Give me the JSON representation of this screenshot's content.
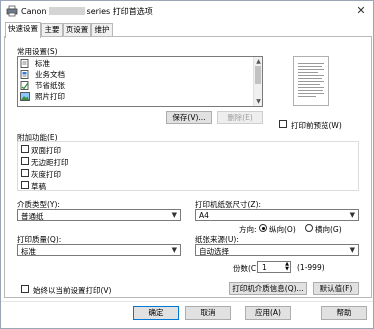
{
  "window": {
    "title_prefix": "Canon",
    "title_suffix": "series 打印首选项",
    "close_glyph": "✕"
  },
  "tabs": [
    {
      "label": "快速设置",
      "active": true
    },
    {
      "label": "主要",
      "active": false
    },
    {
      "label": "页设置",
      "active": false
    },
    {
      "label": "维护",
      "active": false
    }
  ],
  "common_settings": {
    "label": "常用设置(S)",
    "items": [
      {
        "label": "标准",
        "icon": "standard-document-icon"
      },
      {
        "label": "业务文档",
        "icon": "business-document-icon"
      },
      {
        "label": "节省纸张",
        "icon": "paper-saving-icon"
      },
      {
        "label": "照片打印",
        "icon": "photo-print-icon"
      }
    ],
    "save_label": "保存(V)...",
    "delete_label": "删除(E)"
  },
  "preview": {
    "preview_before_print_label": "打印前预览(W)"
  },
  "additional_features": {
    "label": "附加功能(E)",
    "items": [
      {
        "label": "双面打印",
        "checked": false
      },
      {
        "label": "无边距打印",
        "checked": false
      },
      {
        "label": "灰度打印",
        "checked": false
      },
      {
        "label": "草稿",
        "checked": false
      }
    ]
  },
  "media_type": {
    "label": "介质类型(Y):",
    "value": "普通纸"
  },
  "print_quality": {
    "label": "打印质量(Q):",
    "value": "标准"
  },
  "printer_paper_size": {
    "label": "打印机纸张尺寸(Z):",
    "value": "A4"
  },
  "orientation": {
    "label": "方向:",
    "portrait_label": "纵向(O)",
    "landscape_label": "横向(G)",
    "selected": "portrait"
  },
  "paper_source": {
    "label": "纸张来源(U):",
    "value": "自动选择"
  },
  "copies": {
    "label": "份数(C):",
    "value": "1",
    "range": "(1-999)"
  },
  "always_print_current": {
    "label": "始终以当前设置打印(V)",
    "checked": false
  },
  "media_info_button": "打印机介质信息(Q)...",
  "defaults_button": "默认值(F)",
  "footer": {
    "ok": "确定",
    "cancel": "取消",
    "apply": "应用(A)",
    "help": "帮助"
  },
  "colors": {
    "primary_border": "#0078d7",
    "button_bg": "#e1e1e1",
    "disabled_text": "#a0a0a0"
  }
}
